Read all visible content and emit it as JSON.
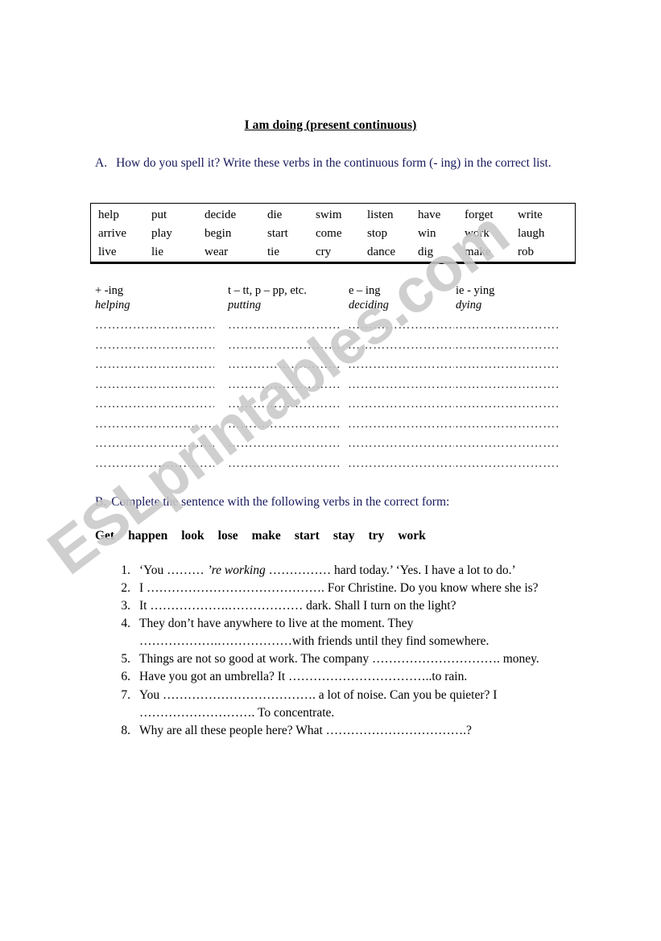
{
  "document": {
    "title": "I am doing (present continuous)",
    "watermark": "ESLprintables.com"
  },
  "section_a": {
    "letter": "A.",
    "instruction": "How do you spell it? Write these verbs in the continuous form (- ing) in the correct list.",
    "verb_box": {
      "columns": [
        [
          "help",
          "arrive",
          "live"
        ],
        [
          "put",
          "play",
          "lie"
        ],
        [
          "decide",
          "begin",
          "wear"
        ],
        [
          "die",
          "start",
          "tie"
        ],
        [
          "swim",
          "come",
          "cry"
        ],
        [
          "listen",
          "stop",
          "dance"
        ],
        [
          "have",
          "win",
          "dig"
        ],
        [
          "forget",
          "work",
          "make"
        ],
        [
          "write",
          "laugh",
          "rob"
        ]
      ]
    },
    "categories": [
      {
        "label": "+ -ing",
        "example": "helping"
      },
      {
        "label": "t – tt, p – pp, etc.",
        "example": "putting"
      },
      {
        "label": "e – ing",
        "example": "deciding"
      },
      {
        "label": "ie - ying",
        "example": "dying"
      }
    ],
    "answer_line_rows": 8,
    "answer_line_dots": "……………………………………………………"
  },
  "section_b": {
    "letter": "B.",
    "instruction": "Complete the sentence with the following verbs in the correct form:",
    "word_bank": [
      "Get",
      "happen",
      "look",
      "lose",
      "make",
      "start",
      "stay",
      "try",
      "work"
    ],
    "questions": [
      {
        "number": "1.",
        "parts": [
          {
            "text": "‘You ……… ",
            "italic": false
          },
          {
            "text": "’re working",
            "italic": true
          },
          {
            "text": " …………… hard today.’ ‘Yes. I have a lot to do.’",
            "italic": false
          }
        ]
      },
      {
        "number": "2.",
        "parts": [
          {
            "text": "I ……………………………………. For Christine. Do you know where she is?",
            "italic": false
          }
        ]
      },
      {
        "number": "3.",
        "parts": [
          {
            "text": "It ……………….……………… dark. Shall I turn on the light?",
            "italic": false
          }
        ]
      },
      {
        "number": "4.",
        "parts": [
          {
            "text": "They don’t have anywhere to live at the moment. They ……………….………………with friends until they find somewhere.",
            "italic": false
          }
        ]
      },
      {
        "number": "5.",
        "parts": [
          {
            "text": "Things are not so good at work. The company …………………………. money.",
            "italic": false
          }
        ]
      },
      {
        "number": "6.",
        "parts": [
          {
            "text": "Have you got an umbrella? It ……………………………..to rain.",
            "italic": false
          }
        ]
      },
      {
        "number": "7.",
        "parts": [
          {
            "text": "You ………………………………. a lot of noise. Can you be quieter? I ………………………. To concentrate.",
            "italic": false
          }
        ]
      },
      {
        "number": "8.",
        "parts": [
          {
            "text": "Why are all these people here? What …………………………….?",
            "italic": false
          }
        ]
      }
    ]
  },
  "colors": {
    "instruction_navy": "#16185a",
    "watermark_gray": "#c9c9c9",
    "text_black": "#000000"
  }
}
